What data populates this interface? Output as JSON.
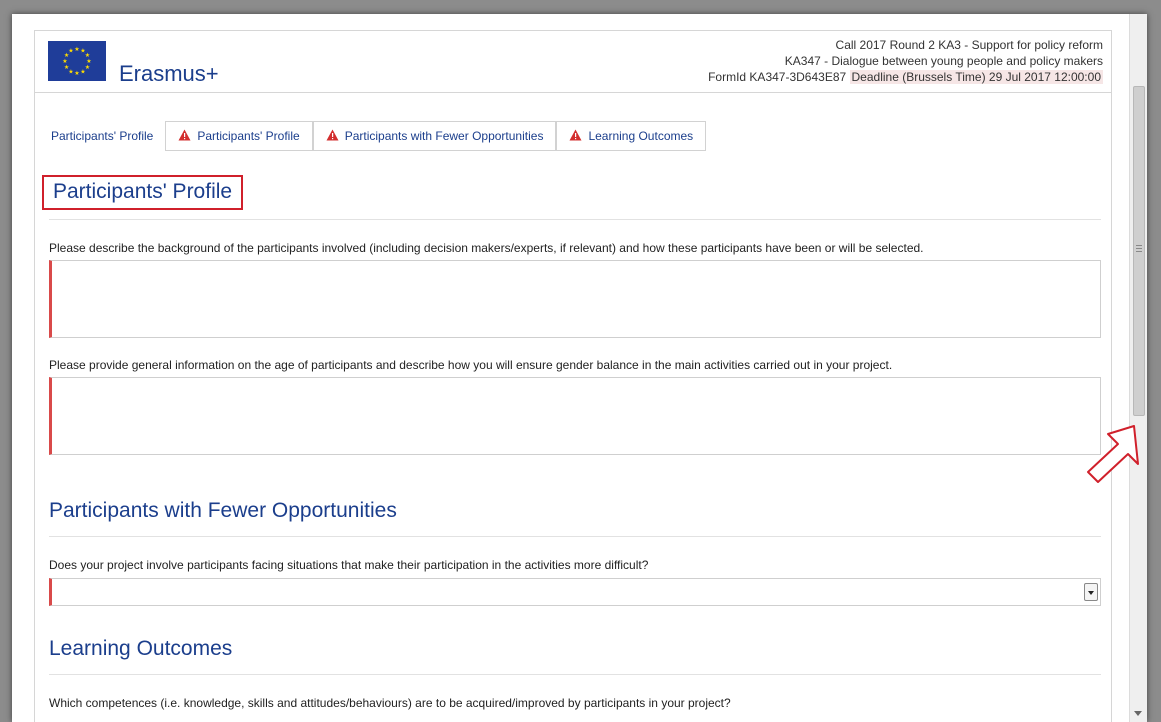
{
  "header": {
    "brand": "Erasmus+",
    "call_line": "Call 2017  Round 2  KA3 - Support for policy reform",
    "action_line": "KA347 - Dialogue between young people and policy makers",
    "form_id": "FormId KA347-3D643E87",
    "deadline": "Deadline (Brussels Time) 29 Jul 2017 12:00:00"
  },
  "tabs": [
    {
      "label": "Participants' Profile",
      "warning": false
    },
    {
      "label": "Participants' Profile",
      "warning": true
    },
    {
      "label": "Participants with Fewer Opportunities",
      "warning": true
    },
    {
      "label": "Learning Outcomes",
      "warning": true
    }
  ],
  "sections": {
    "profile": {
      "title": "Participants' Profile",
      "q1": "Please describe the background of the participants involved (including decision makers/experts, if relevant) and how these participants have been or will be selected.",
      "q2": "Please provide general information on the age of participants and describe how you will ensure gender balance in the main activities carried out in your project."
    },
    "fewer": {
      "title": "Participants with Fewer Opportunities",
      "q1": "Does your project involve participants facing situations that make their participation in the activities more difficult?",
      "select_value": ""
    },
    "learning": {
      "title": "Learning Outcomes",
      "q1": "Which competences (i.e. knowledge, skills and attitudes/behaviours) are to be acquired/improved by participants in your project?"
    }
  },
  "colors": {
    "brand_blue": "#1b3e8c",
    "eu_flag_blue": "#1f3d99",
    "eu_star_yellow": "#ffdd00",
    "required_red": "#d94a4a",
    "highlight_red": "#d0202b",
    "warning_red": "#d32f2f"
  },
  "icons": [
    "eu-flag-logo",
    "warning-icon",
    "dropdown-arrow-icon",
    "scroll-grip-icon",
    "pointer-arrow-icon"
  ]
}
